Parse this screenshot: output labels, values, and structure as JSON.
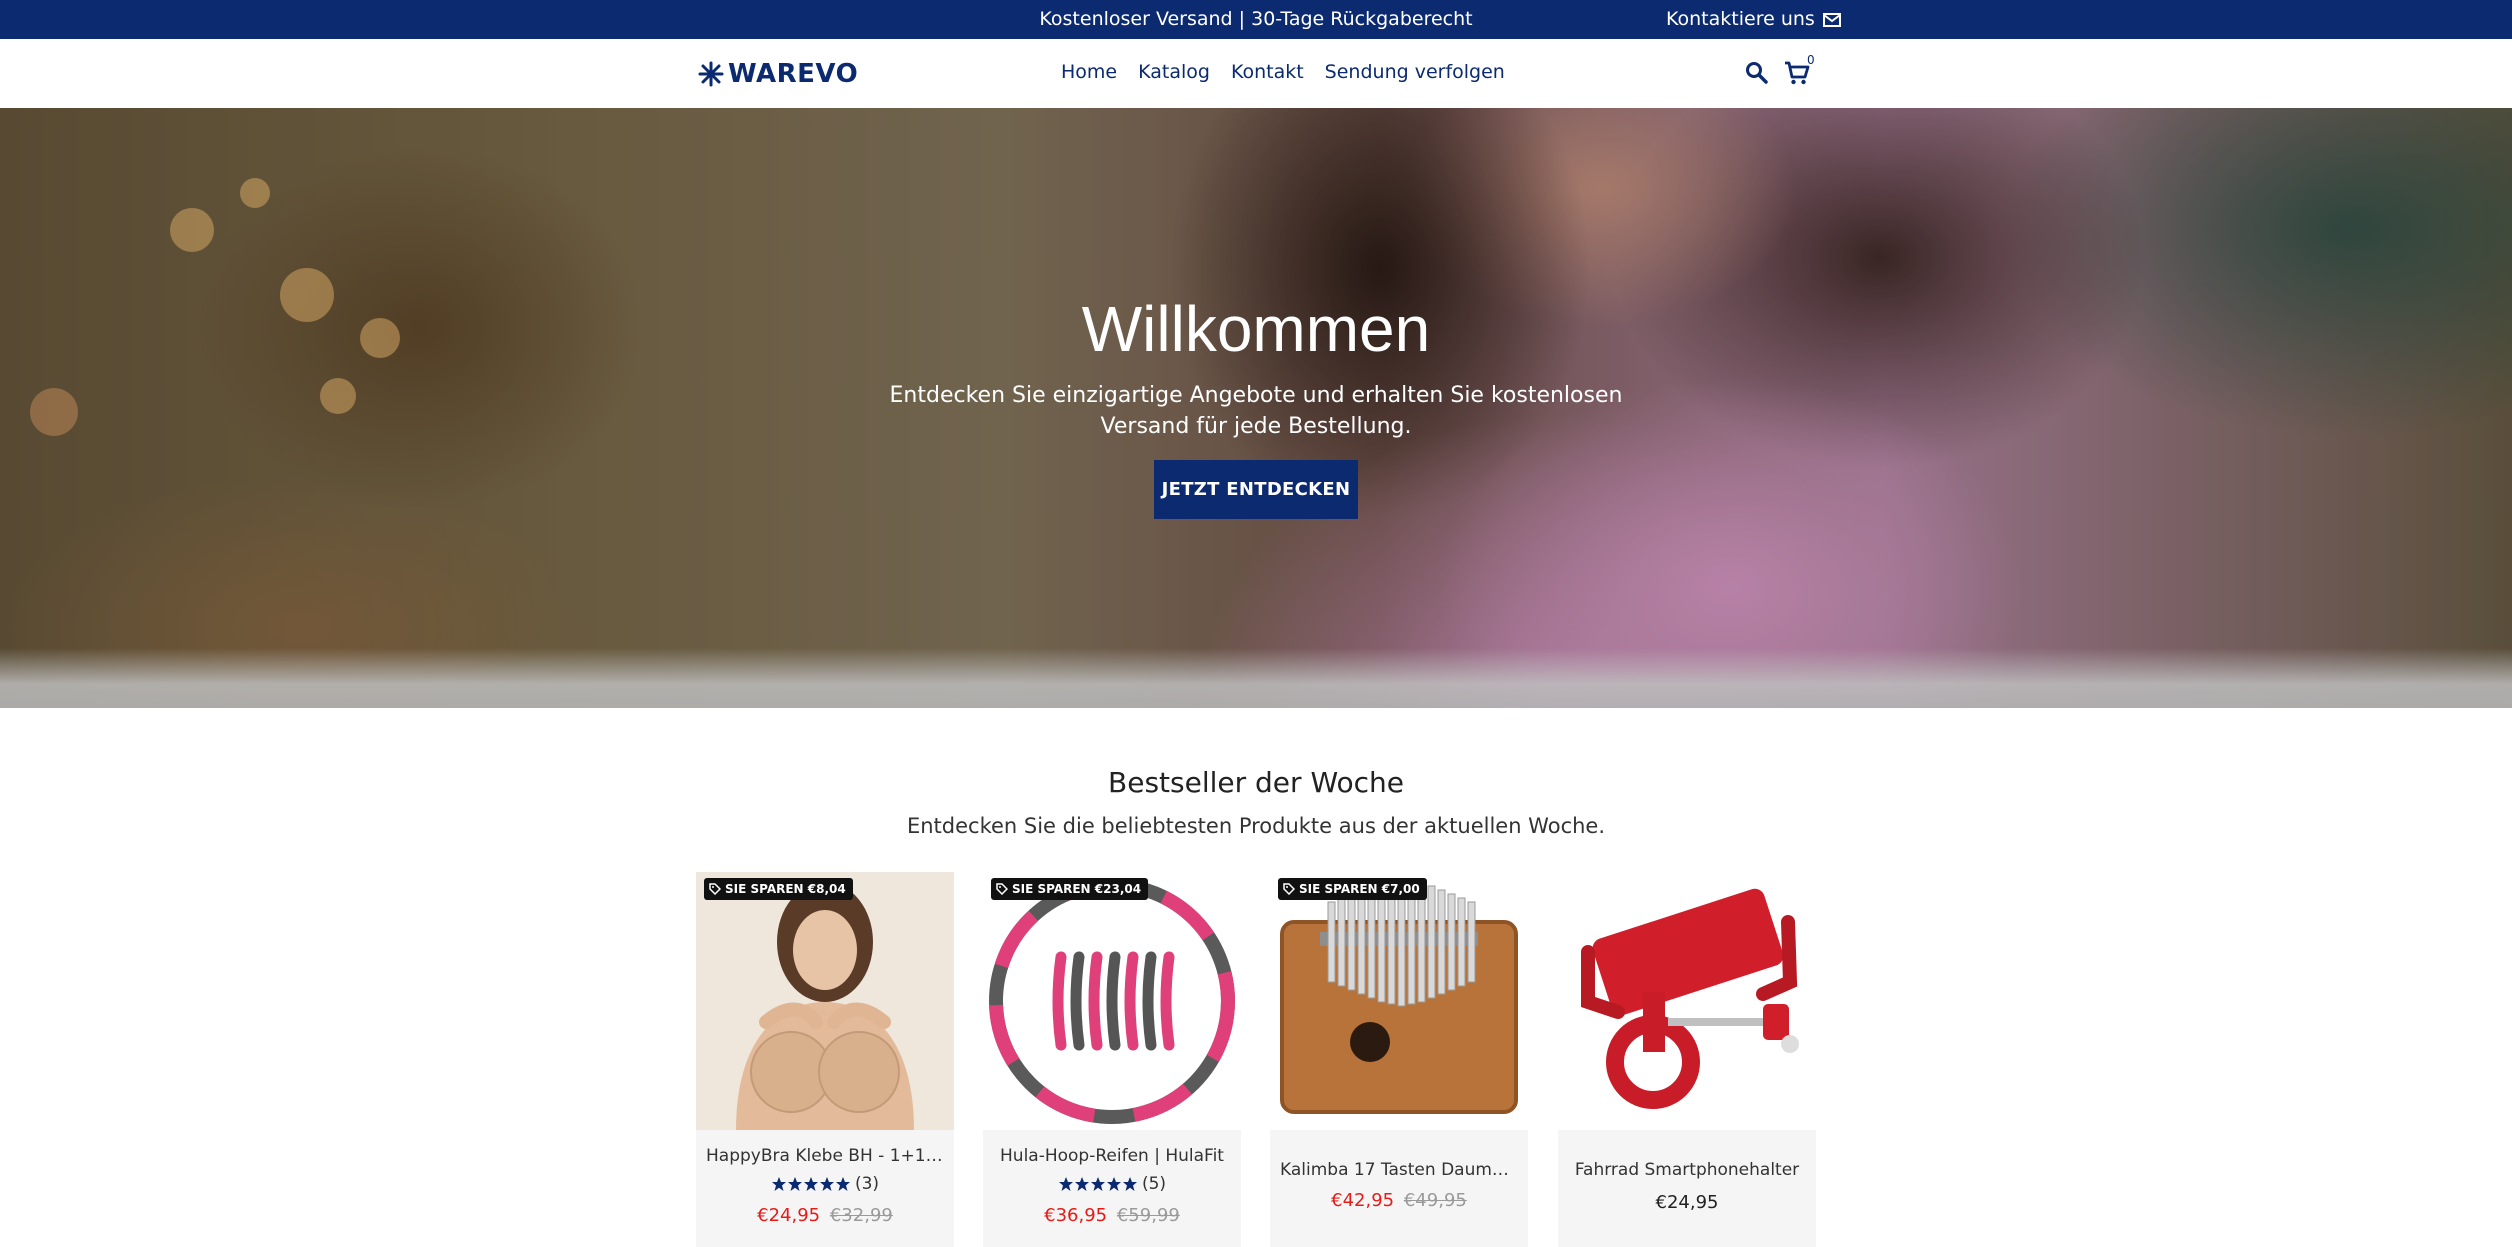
{
  "announcement": {
    "text": "Kostenloser Versand | 30-Tage Rückgaberecht",
    "contact_label": "Kontaktiere uns"
  },
  "header": {
    "logo_text": "WAREVO",
    "nav": [
      {
        "label": "Home"
      },
      {
        "label": "Katalog"
      },
      {
        "label": "Kontakt"
      },
      {
        "label": "Sendung verfolgen"
      }
    ],
    "cart_count": "0"
  },
  "hero": {
    "title": "Willkommen",
    "subtitle": "Entdecken Sie einzigartige Angebote und erhalten Sie kostenlosen Versand für jede Bestellung.",
    "cta_label": "JETZT ENTDECKEN"
  },
  "bestsellers": {
    "title": "Bestseller der Woche",
    "subtitle": "Entdecken Sie die beliebtesten Produkte aus der aktuellen Woche.",
    "products": [
      {
        "badge": "SIE SPAREN €8,04",
        "name": "HappyBra Klebe BH - 1+1 ...",
        "rating": 5,
        "reviews": "(3)",
        "price": "€24,95",
        "old_price": "€32,99"
      },
      {
        "badge": "SIE SPAREN €23,04",
        "name": "Hula-Hoop-Reifen | HulaFit",
        "rating": 5,
        "reviews": "(5)",
        "price": "€36,95",
        "old_price": "€59,99"
      },
      {
        "badge": "SIE SPAREN €7,00",
        "name": "Kalimba 17 Tasten Daume...",
        "price": "€42,95",
        "old_price": "€49,95"
      },
      {
        "name": "Fahrrad Smartphonehalter",
        "price": "€24,95"
      }
    ]
  },
  "colors": {
    "brand": "#0b2a6f",
    "sale": "#e41b17",
    "badge": "#111111"
  }
}
